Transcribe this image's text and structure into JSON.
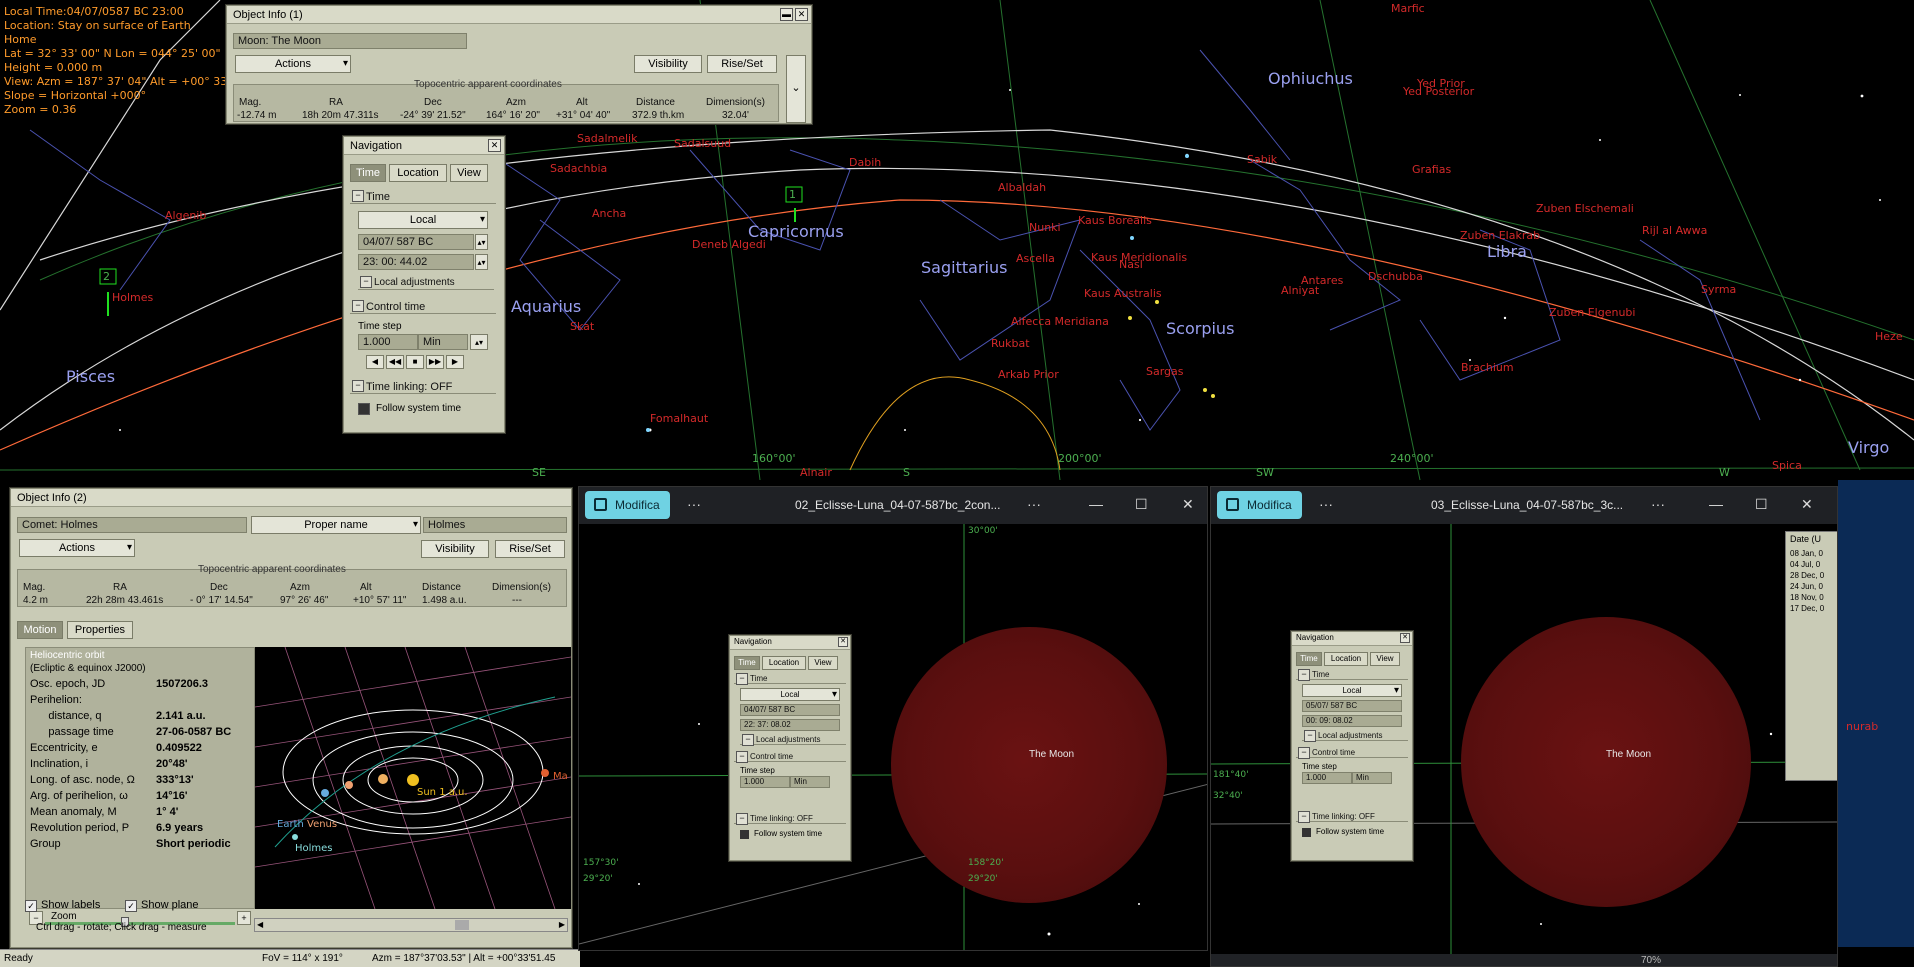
{
  "hud": {
    "lines": [
      "Local Time:04/07/0587 BC 23:00",
      "Location: Stay on surface of Earth",
      "Home",
      "Lat = 32° 33' 00\" N   Lon = 044° 25' 00\" E",
      "Height = 0.000 m",
      "View: Azm = 187° 37' 04\"  Alt = +00° 33' 5",
      "Slope = Horizontal +000°",
      "Zoom = 0.36"
    ]
  },
  "sky": {
    "constellations": [
      "Ophiuchus",
      "Capricornus",
      "Sagittarius",
      "Aquarius",
      "Scorpius",
      "Libra",
      "Pisces",
      "Virgo"
    ],
    "stars": [
      "Marfic",
      "Yed Prior",
      "Yed Posterior",
      "Sadalmelik",
      "Sadalsuud",
      "Sadachbia",
      "Algenib",
      "Homes",
      "Ancha",
      "Dabih",
      "Albaldah",
      "Nunki",
      "Kaus Borealis",
      "Kaus Meridionalis",
      "Kaus Australis",
      "Ascella",
      "Nasl",
      "Sabik",
      "Grafias",
      "Zuben Elschemali",
      "Zuben Elakrab",
      "Rijl al Awwa",
      "Alniyat",
      "Antares",
      "Dschubba",
      "Zuben Elgenubi",
      "Syrma",
      "Heze",
      "Brachium",
      "Sargas",
      "Rukbat",
      "Arkab Prior",
      "Alfecca Meridiana",
      "Fomalhaut",
      "Skat",
      "Deneb Algedi",
      "Spica",
      "Alnair"
    ],
    "grid_labels": [
      "160°00'",
      "200°00'",
      "240°00'",
      "SE",
      "S",
      "SW",
      "W"
    ],
    "markers": [
      "1",
      "2"
    ],
    "holmes_label": "Holmes"
  },
  "object_info_1": {
    "title": "Object Info (1)",
    "object": "Moon: The Moon",
    "actions": "Actions",
    "visibility": "Visibility",
    "riseset": "Rise/Set",
    "group_label": "Topocentric apparent coordinates",
    "headers": [
      "Mag.",
      "RA",
      "Dec",
      "Azm",
      "Alt",
      "Distance",
      "Dimension(s)"
    ],
    "values": [
      "-12.74 m",
      "18h 20m 47.311s",
      "-24° 39' 21.52\"",
      "164° 16' 20\"",
      "+31° 04' 40\"",
      "372.9 th.km",
      "32.04'"
    ]
  },
  "navigation": {
    "title": "Navigation",
    "tabs": [
      "Time",
      "Location",
      "View"
    ],
    "time_section": "Time",
    "mode": "Local",
    "date": "04/07/ 587  BC",
    "time": "23: 00: 44.02",
    "local_adj": "Local adjustments",
    "control_section": "Control time",
    "time_step_label": "Time step",
    "time_step": "1.000",
    "time_step_unit": "Min",
    "linking": "Time linking: OFF",
    "follow": "Follow system time"
  },
  "object_info_2": {
    "title": "Object Info (2)",
    "object": "Comet: Holmes",
    "name_mode": "Proper name",
    "name_value": "Holmes",
    "actions": "Actions",
    "visibility": "Visibility",
    "riseset": "Rise/Set",
    "group_label": "Topocentric apparent coordinates",
    "headers": [
      "Mag.",
      "RA",
      "Dec",
      "Azm",
      "Alt",
      "Distance",
      "Dimension(s)"
    ],
    "values": [
      "4.2 m",
      "22h 28m 43.461s",
      "- 0° 17' 14.54\"",
      "97° 26' 46\"",
      "+10° 57' 11\"",
      "1.498 a.u.",
      "---"
    ],
    "tabs": [
      "Motion",
      "Properties"
    ],
    "orbit_title": "Heliocentric orbit",
    "orbit_subtitle": "(Ecliptic & equinox J2000)",
    "orbit_rows": [
      {
        "k": "Osc. epoch, JD",
        "v": "1507206.3"
      },
      {
        "k": "Perihelion:",
        "v": ""
      },
      {
        "k": "      distance, q",
        "v": "2.141 a.u."
      },
      {
        "k": "      passage time",
        "v": "27-06-0587 BC"
      },
      {
        "k": "Eccentricity, e",
        "v": "0.409522"
      },
      {
        "k": "Inclination, i",
        "v": "20°48'"
      },
      {
        "k": "Long. of asc. node, Ω",
        "v": "333°13'"
      },
      {
        "k": "Arg. of perihelion, ω",
        "v": "14°16'"
      },
      {
        "k": "Mean anomaly, M",
        "v": "1° 4'"
      },
      {
        "k": "Revolution period, P",
        "v": "6.9 years"
      },
      {
        "k": "Group",
        "v": "Short periodic"
      }
    ],
    "zoom_label": "Zoom",
    "show_labels": "Show labels",
    "show_plane": "Show plane",
    "hint": "Ctrl drag - rotate; Click drag - measure",
    "orbit_labels": [
      "Earth",
      "Venus",
      "Sun 1 a.u.",
      "Holmes",
      "Ma"
    ]
  },
  "status": {
    "ready": "Ready",
    "fov": "FoV = 114° x 191°",
    "azm": "Azm = 187°37'03.53\" | Alt = +00°33'51.45"
  },
  "viewer1": {
    "edit": "Modifica",
    "title": "02_Eclisse-Luna_04-07-587bc_2con...",
    "moon_label": "The Moon",
    "grid": [
      "157°30'",
      "29°20'",
      "158°20'",
      "29°20'",
      "30°00'"
    ],
    "nav": {
      "title": "Navigation",
      "tabs": [
        "Time",
        "Location",
        "View"
      ],
      "time_section": "Time",
      "mode": "Local",
      "date": "04/07/ 587  BC",
      "time": "22: 37: 08.02",
      "local_adj": "Local adjustments",
      "control": "Control time",
      "step_label": "Time step",
      "step": "1.000",
      "unit": "Min",
      "linking": "Time linking: OFF",
      "follow": "Follow system time"
    }
  },
  "viewer2": {
    "edit": "Modifica",
    "title": "03_Eclisse-Luna_04-07-587bc_3c...",
    "moon_label": "The Moon",
    "grid": [
      "181°40'",
      "32°40'"
    ],
    "date_header": "Date (U",
    "dates": [
      "08 Jan, 0",
      "04 Jul, 0",
      "28 Dec, 0",
      "24 Jun, 0",
      "18 Nov, 0",
      "17 Dec, 0"
    ],
    "right_label": "nurab",
    "zoom_pct": "70%",
    "nav": {
      "title": "Navigation",
      "tabs": [
        "Time",
        "Location",
        "View"
      ],
      "time_section": "Time",
      "mode": "Local",
      "date": "05/07/ 587  BC",
      "time": "00: 09: 08.02",
      "local_adj": "Local adjustments",
      "control": "Control time",
      "step_label": "Time step",
      "step": "1.000",
      "unit": "Min",
      "linking": "Time linking: OFF",
      "follow": "Follow system time"
    }
  }
}
